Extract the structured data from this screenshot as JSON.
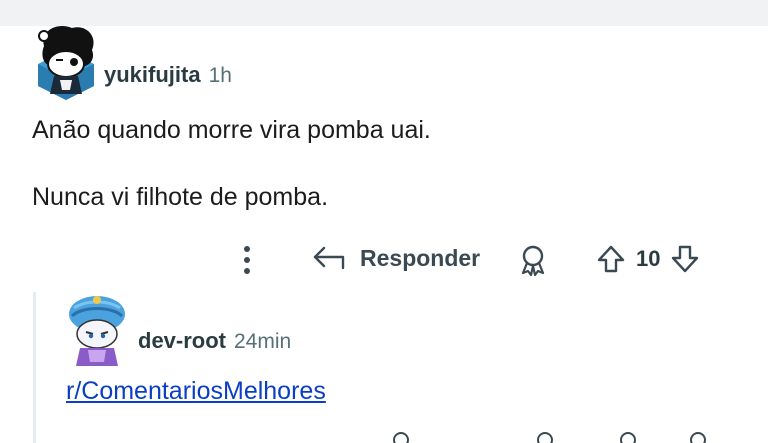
{
  "comment": {
    "username": "yukifujita",
    "time": "1h",
    "line1": "Anão quando morre vira pomba uai.",
    "line2": "Nunca vi filhote de pomba.",
    "reply_label": "Responder",
    "score": "10"
  },
  "reply_comment": {
    "username": "dev-root",
    "time": "24min",
    "link": "r/ComentariosMelhores"
  },
  "icons": {
    "more": "more-vertical-icon",
    "reply": "reply-arrow-icon",
    "award": "award-icon",
    "upvote": "upvote-arrow-icon",
    "downvote": "downvote-arrow-icon"
  },
  "colors": {
    "link": "#0b3ec4",
    "text": "#1c1c1c",
    "meta": "#576f76",
    "icon": "#3b4a52"
  }
}
